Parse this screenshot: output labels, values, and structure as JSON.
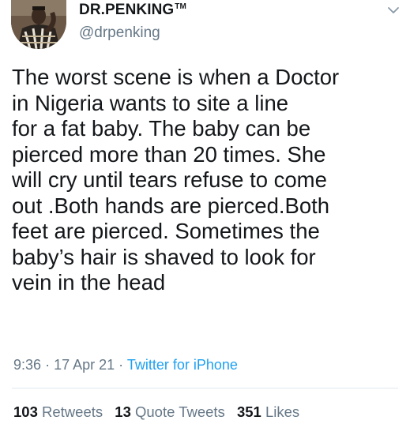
{
  "author": {
    "display_name": "DR.PENKING",
    "trademark": "TM",
    "handle": "@drpenking"
  },
  "tweet": {
    "text": "The worst scene is when a Doctor\nin Nigeria wants to site a line\nfor a fat baby. The baby can be\npierced more than 20 times. She\nwill cry until tears refuse to come\nout .Both hands are pierced.Both\nfeet are pierced. Sometimes the\nbaby’s hair is shaved to look for\nvein in the head",
    "time": "9:36",
    "separator": "·",
    "date": "17 Apr 21",
    "source": "Twitter for iPhone"
  },
  "stats": {
    "retweets_count": "103",
    "retweets_label": "Retweets",
    "quotes_count": "13",
    "quotes_label": "Quote Tweets",
    "likes_count": "351",
    "likes_label": "Likes"
  },
  "icons": {
    "menu": "chevron-down-icon"
  },
  "colors": {
    "text": "#14171a",
    "muted": "#657786",
    "link": "#1da1f2",
    "divider": "#e1e8ed"
  }
}
